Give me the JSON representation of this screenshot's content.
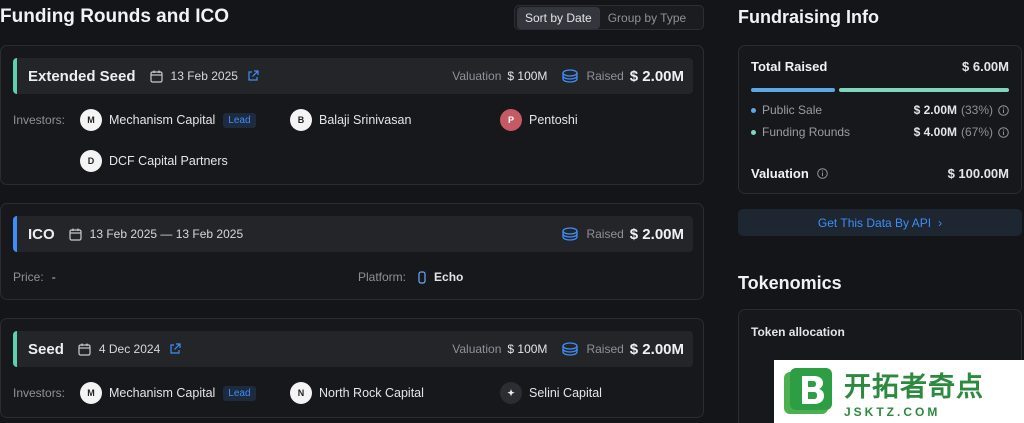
{
  "funding": {
    "title": "Funding Rounds and ICO",
    "sort_options": [
      "Sort by Date",
      "Group by Type"
    ],
    "rounds": [
      {
        "name": "Extended Seed",
        "date": "13 Feb 2025",
        "valuation_label": "Valuation",
        "valuation": "$ 100M",
        "raised_label": "Raised",
        "raised": "$ 2.00M",
        "investors_label": "Investors:",
        "investors": [
          {
            "name": "Mechanism Capital",
            "lead": "Lead"
          },
          {
            "name": "Balaji Srinivasan"
          },
          {
            "name": "Pentoshi"
          },
          {
            "name": "DCF Capital Partners"
          }
        ]
      },
      {
        "name": "ICO",
        "date": "13 Feb 2025 — 13 Feb 2025",
        "raised_label": "Raised",
        "raised": "$ 2.00M",
        "price_label": "Price:",
        "price": "-",
        "platform_label": "Platform:",
        "platform": "Echo"
      },
      {
        "name": "Seed",
        "date": "4 Dec 2024",
        "valuation_label": "Valuation",
        "valuation": "$ 100M",
        "raised_label": "Raised",
        "raised": "$ 2.00M",
        "investors_label": "Investors:",
        "investors": [
          {
            "name": "Mechanism Capital",
            "lead": "Lead"
          },
          {
            "name": "North Rock Capital"
          },
          {
            "name": "Selini Capital"
          }
        ]
      }
    ]
  },
  "fundraising": {
    "title": "Fundraising Info",
    "total_label": "Total Raised",
    "total": "$ 6.00M",
    "public_sale_share": 0.33,
    "funding_rounds_share": 0.67,
    "public_sale_label": "Public Sale",
    "public_sale_amount": "$ 2.00M",
    "public_sale_pct": "(33%)",
    "funding_rounds_label": "Funding Rounds",
    "funding_rounds_amount": "$ 4.00M",
    "funding_rounds_pct": "(67%)",
    "valuation_label": "Valuation",
    "valuation": "$ 100.00M",
    "api_link": "Get This Data By API",
    "colors": {
      "public_sale": "#5aa9e6",
      "funding_rounds": "#7fd6b8",
      "accent": "#3e8ef7"
    }
  },
  "tokenomics": {
    "title": "Tokenomics",
    "allocation_label": "Token allocation"
  },
  "watermark": {
    "cn": "开拓者奇点",
    "en": "JSKTZ.COM"
  }
}
